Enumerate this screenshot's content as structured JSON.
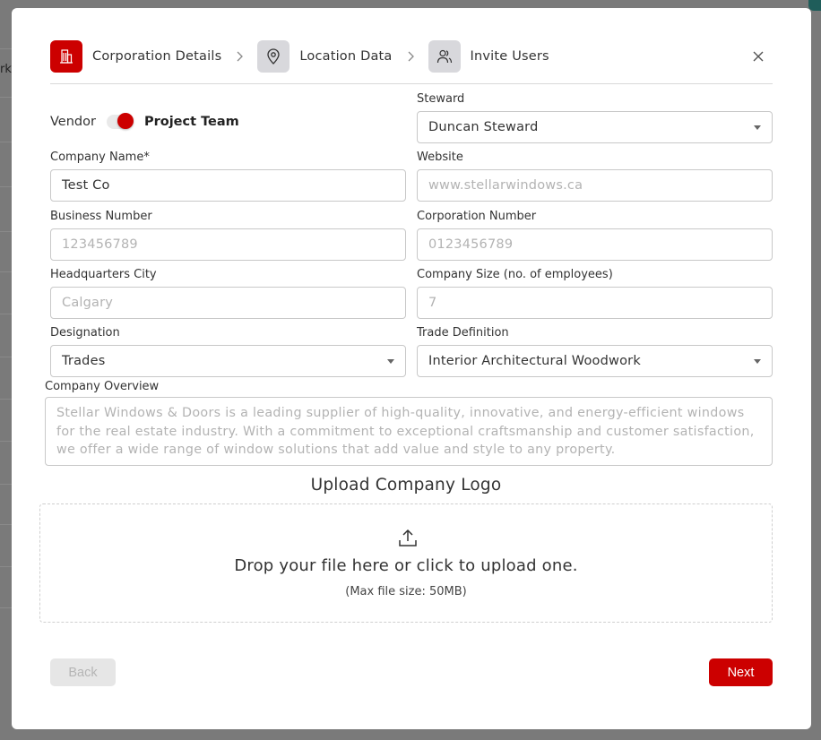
{
  "background": {
    "edge_text": "rk"
  },
  "stepper": {
    "steps": [
      {
        "label": "Corporation Details",
        "icon": "building-icon",
        "state": "active"
      },
      {
        "label": "Location Data",
        "icon": "location-pin-icon",
        "state": "inactive"
      },
      {
        "label": "Invite Users",
        "icon": "users-icon",
        "state": "inactive"
      }
    ]
  },
  "toggle": {
    "option_left": "Vendor",
    "option_right": "Project Team",
    "selected": "Project Team"
  },
  "fields": {
    "steward": {
      "label": "Steward",
      "value": "Duncan Steward"
    },
    "company_name": {
      "label": "Company Name*",
      "value": "Test Co"
    },
    "website": {
      "label": "Website",
      "placeholder": "www.stellarwindows.ca"
    },
    "business_number": {
      "label": "Business Number",
      "placeholder": "123456789"
    },
    "corporation_number": {
      "label": "Corporation Number",
      "placeholder": "0123456789"
    },
    "hq_city": {
      "label": "Headquarters City",
      "placeholder": "Calgary"
    },
    "company_size": {
      "label": "Company Size (no. of employees)",
      "placeholder": "7"
    },
    "designation": {
      "label": "Designation",
      "value": "Trades"
    },
    "trade_definition": {
      "label": "Trade Definition",
      "value": "Interior Architectural Woodwork"
    },
    "company_overview": {
      "label": "Company Overview",
      "placeholder": "Stellar Windows & Doors is a leading supplier of high-quality, innovative, and energy-efficient windows for the real estate industry. With a commitment to exceptional craftsmanship and customer satisfaction, we offer a wide range of window solutions that add value and style to any property."
    }
  },
  "upload": {
    "title": "Upload Company Logo",
    "drop_text": "Drop your file here or click to upload one.",
    "max_size": "(Max file size: 50MB)"
  },
  "footer": {
    "back_label": "Back",
    "next_label": "Next"
  },
  "colors": {
    "accent": "#cc0000",
    "inactive_step": "#d8d8dc",
    "border": "#c8c8c8",
    "placeholder": "#b3b3b3"
  }
}
